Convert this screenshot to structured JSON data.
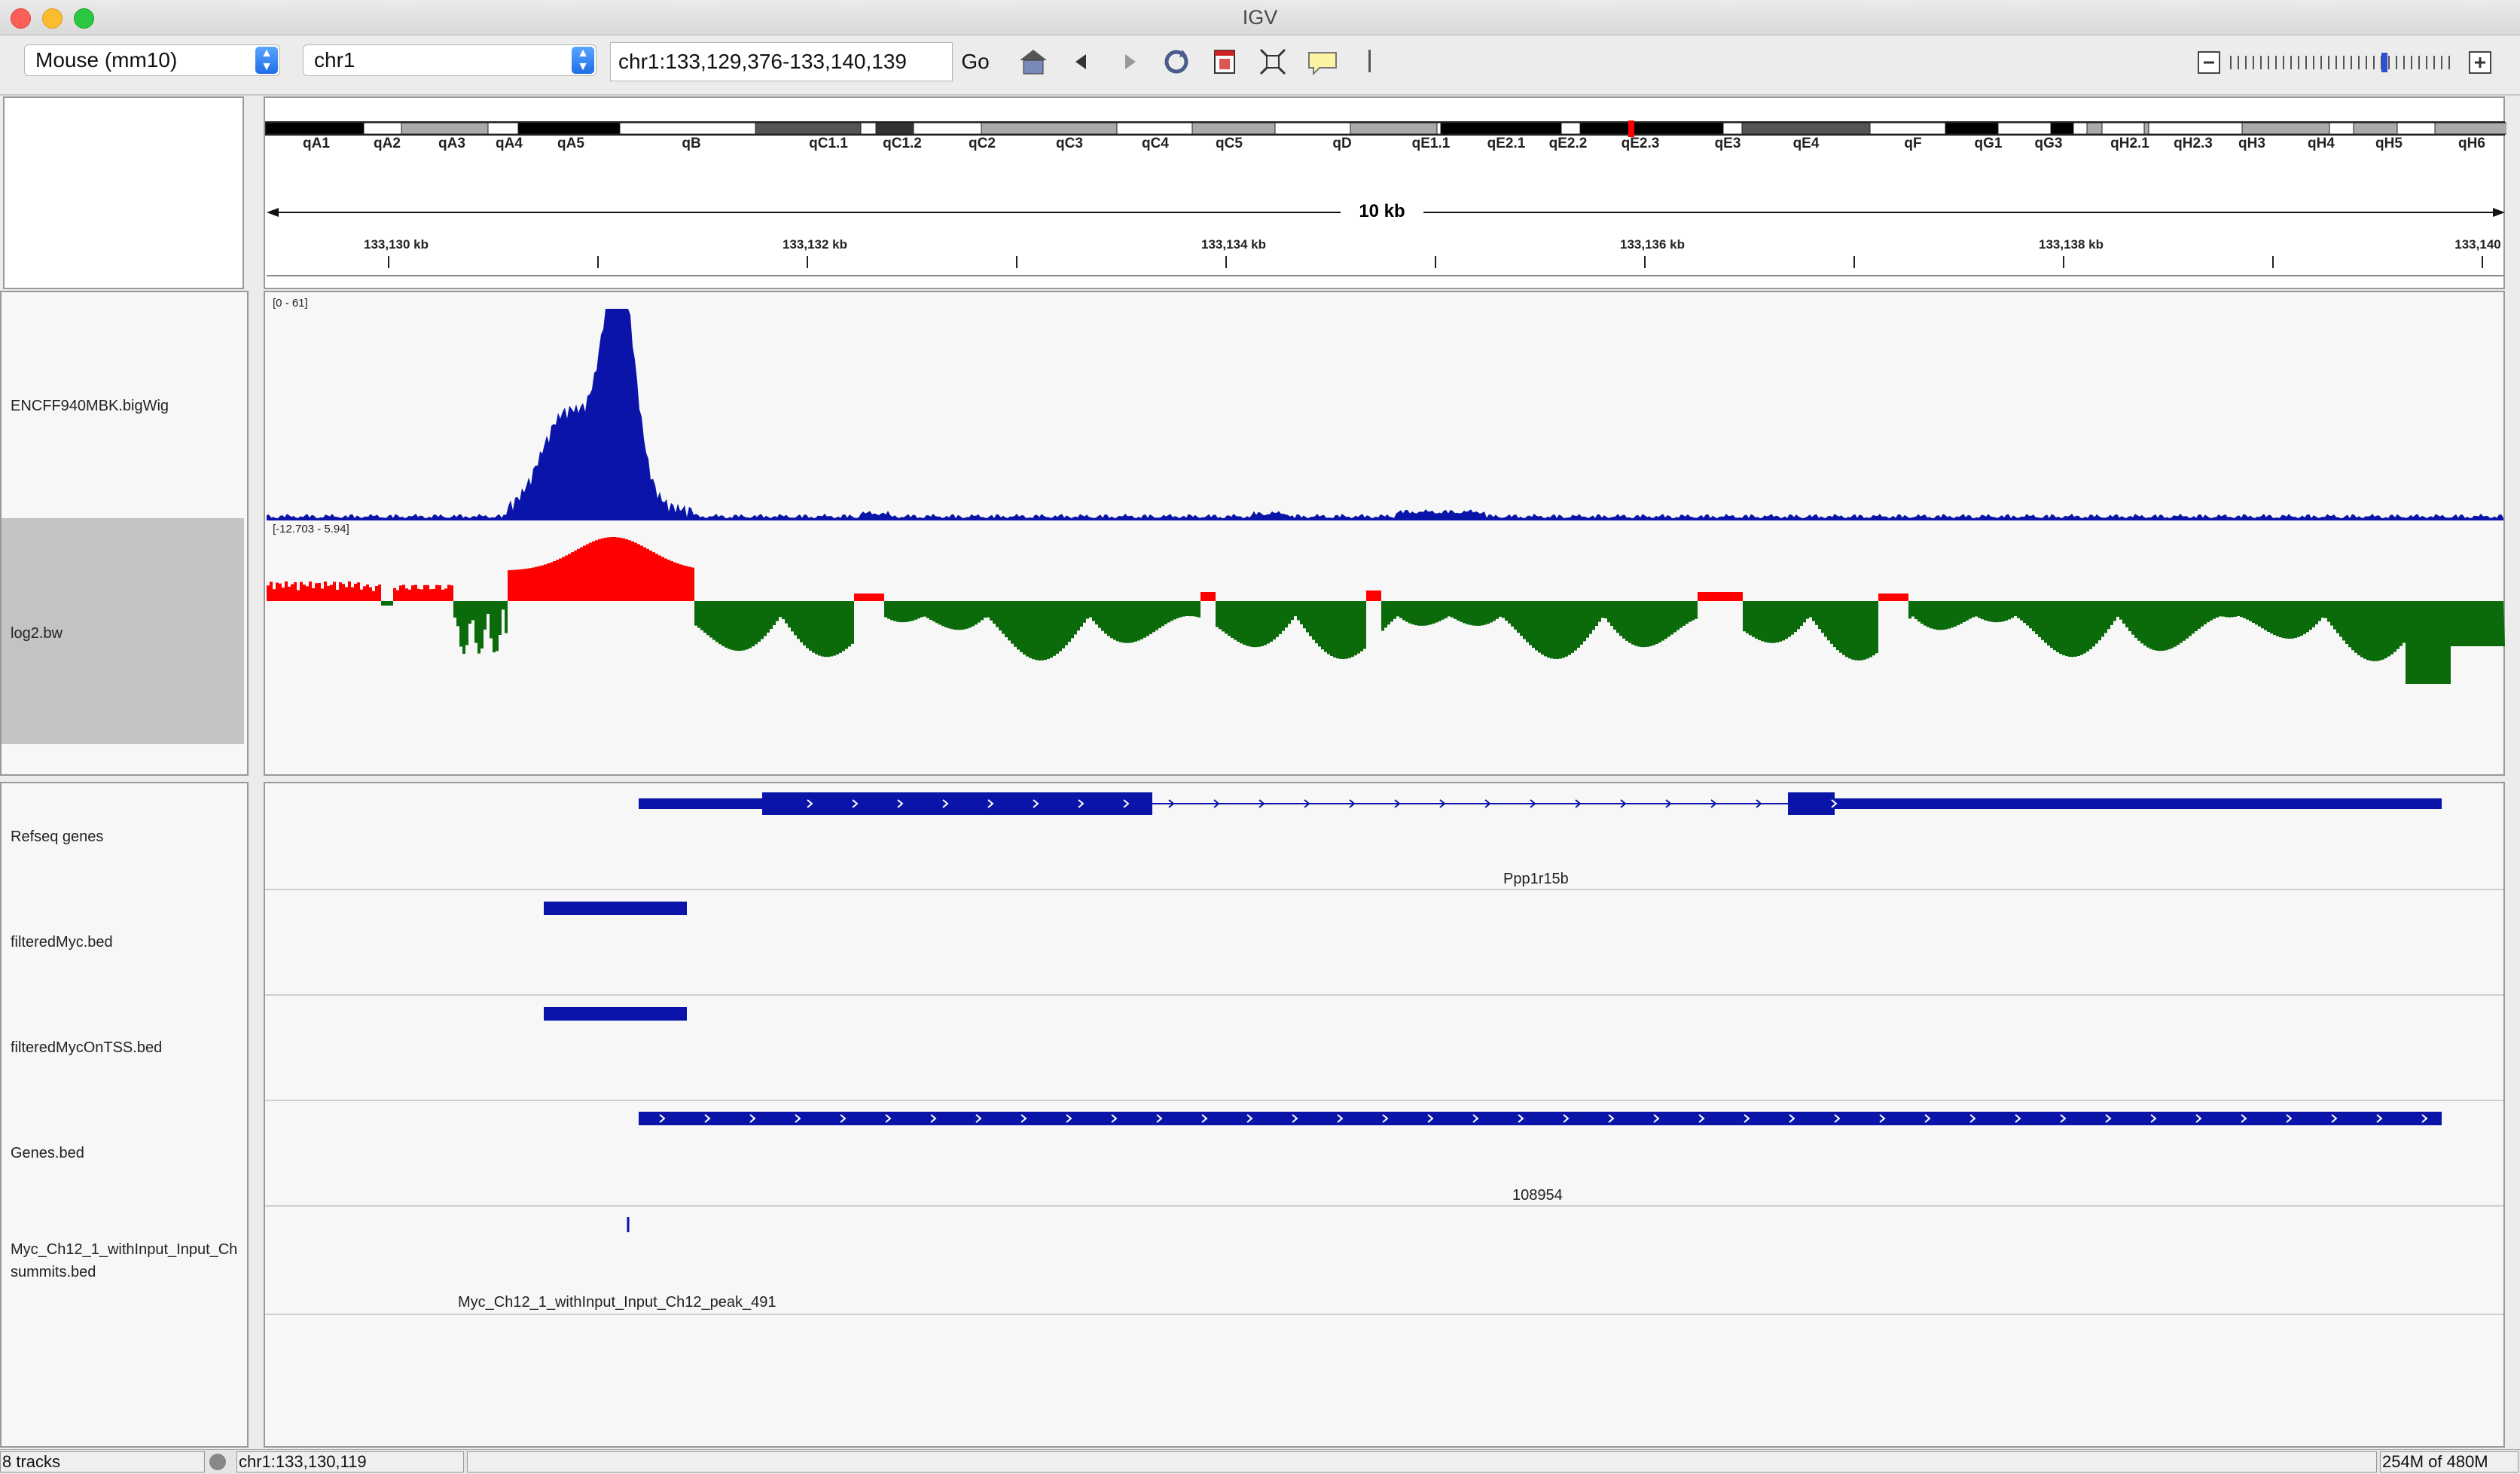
{
  "window": {
    "title": "IGV"
  },
  "toolbar": {
    "genome": "Mouse (mm10)",
    "chromosome": "chr1",
    "locus": "chr1:133,129,376-133,140,139",
    "go_label": "Go"
  },
  "ruler": {
    "span_label": "10 kb",
    "ticks": [
      "133,130 kb",
      "133,132 kb",
      "133,134 kb",
      "133,136 kb",
      "133,138 kb",
      "133,140"
    ],
    "bands": [
      "qA1",
      "qA2",
      "qA3",
      "qA4",
      "qA5",
      "qB",
      "qC1.1",
      "qC1.2",
      "qC2",
      "qC3",
      "qC4",
      "qC5",
      "qD",
      "qE1.1",
      "qE2.1",
      "qE2.2",
      "qE2.3",
      "qE3",
      "qE4",
      "qF",
      "qG1",
      "qG3",
      "qH2.1",
      "qH2.3",
      "qH3",
      "qH4",
      "qH5",
      "qH6"
    ]
  },
  "tracks": {
    "bigwig": {
      "name": "ENCFF940MBK.bigWig",
      "range": "[0 - 61]"
    },
    "log2": {
      "name": "log2.bw",
      "range": "[-12.703 - 5.94]"
    },
    "refseq": {
      "name": "Refseq genes",
      "gene": "Ppp1r15b"
    },
    "filtered_myc": {
      "name": "filteredMyc.bed"
    },
    "filtered_myc_tss": {
      "name": "filteredMycOnTSS.bed"
    },
    "genes_bed": {
      "name": "Genes.bed",
      "gene": "108954"
    },
    "summits": {
      "name_line1": "Myc_Ch12_1_withInput_Input_Ch",
      "name_line2": "summits.bed",
      "feature": "Myc_Ch12_1_withInput_Input_Ch12_peak_491"
    }
  },
  "status": {
    "tracks": "8 tracks",
    "position": "chr1:133,130,119",
    "memory": "254M of 480M"
  },
  "colors": {
    "positive": "#ff0000",
    "negative": "#0b6b0b",
    "coverage": "#0a14a8",
    "feature": "#0a14a8",
    "cytoband_marker": "#ff0000"
  }
}
